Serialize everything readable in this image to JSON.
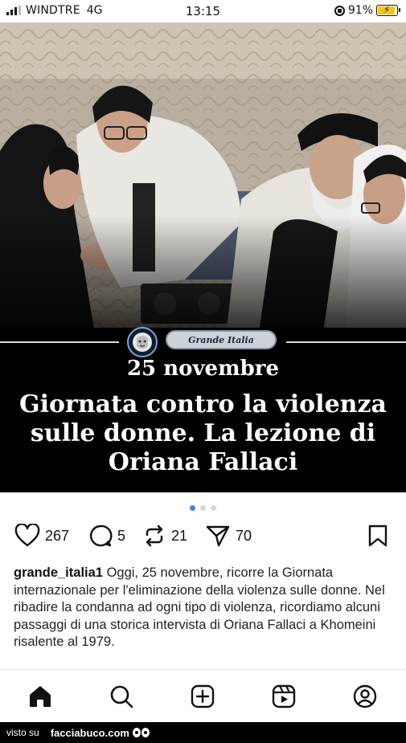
{
  "status_bar": {
    "carrier": "WINDTRE",
    "network": "4G",
    "time": "13:15",
    "battery": "91%",
    "battery_level": 0.91
  },
  "post": {
    "brand_pill": "Grande Italia",
    "date_line": "25 novembre",
    "headline_lines": [
      "Giornata contro la violenza",
      "sulle donne. La lezione di",
      "Oriana Fallaci"
    ],
    "carousel": {
      "total": 3,
      "active": 1
    }
  },
  "actions": {
    "likes": "267",
    "comments": "5",
    "reposts": "21",
    "shares": "70"
  },
  "caption": {
    "username": "grande_italia1",
    "text": "Oggi, 25 novembre, ricorre la Giornata internazionale per l'eliminazione della violenza sulle donne. Nel ribadire la condanna ad ogni tipo di violenza, ricordiamo alcuni passaggi di una storica intervista di Oriana Fallaci a Khomeini risalente al 1979."
  },
  "nav": {
    "items": [
      "home-icon",
      "search-icon",
      "create-icon",
      "reels-icon",
      "profile-icon"
    ]
  },
  "watermark": {
    "prefix": "visto su",
    "site": "facciabuco.com"
  },
  "colors": {
    "active_dot": "#3b82f6",
    "battery_fill": "#f5c518",
    "caption_band": "#000000"
  }
}
